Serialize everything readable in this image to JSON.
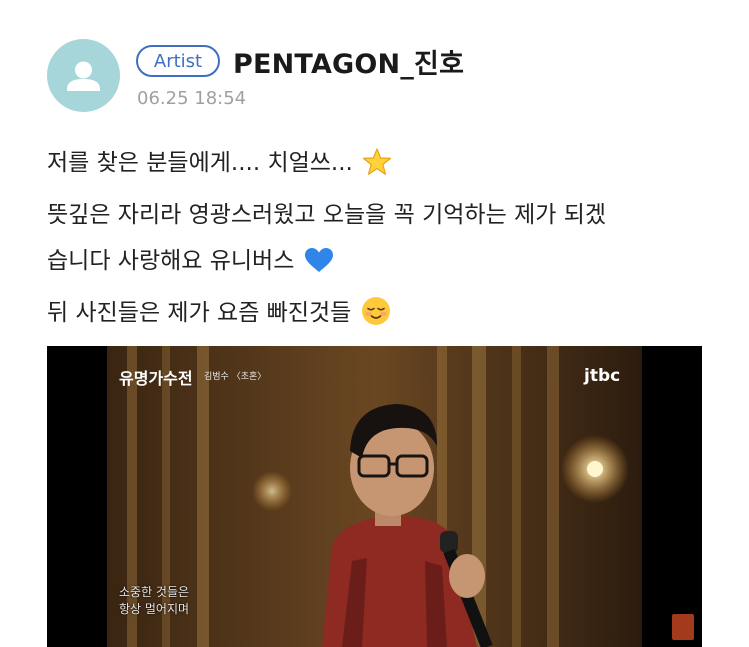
{
  "post": {
    "author_badge": "Artist",
    "author_name": "PENTAGON_진호",
    "timestamp": "06.25 18:54",
    "lines": [
      "저를 찾은 분들에게.... 치얼쓰...",
      "뜻깊은 자리라 영광스러웠고 오늘을 꼭 기억하는 제가 되겠",
      "습니다 사랑해요 유니버스",
      "뒤 사진들은 제가 요즘 빠진것들"
    ],
    "emojis": [
      "star-emoji",
      "blue-heart-emoji",
      "smiling-face-emoji"
    ]
  },
  "photo": {
    "show_title": "유명가수전",
    "song_caption": "김범수 〈초혼〉",
    "broadcaster_logo": "jtbc",
    "subtitle_lines": [
      "소중한 것들은",
      "항상 멀어지며"
    ]
  },
  "colors": {
    "badge": "#3f6fc4",
    "avatar_bg": "#a6d6d9",
    "timestamp": "#a0a0a0"
  }
}
